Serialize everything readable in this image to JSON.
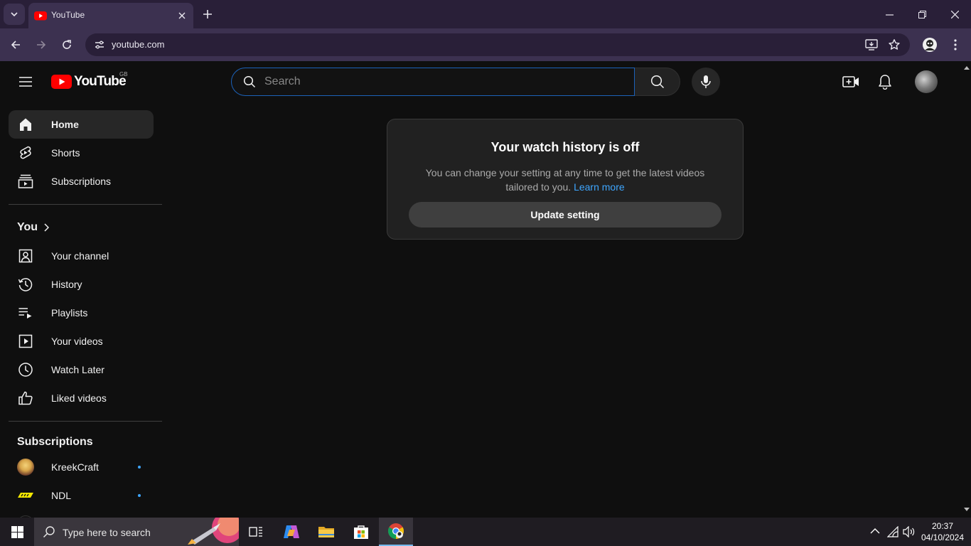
{
  "browser": {
    "tab_title": "YouTube",
    "url": "youtube.com"
  },
  "masthead": {
    "logo_text": "YouTube",
    "country_code": "GB",
    "search_placeholder": "Search"
  },
  "sidebar": {
    "main_items": [
      {
        "label": "Home",
        "icon": "home-icon",
        "active": true
      },
      {
        "label": "Shorts",
        "icon": "shorts-icon"
      },
      {
        "label": "Subscriptions",
        "icon": "subscriptions-icon"
      }
    ],
    "you_header": "You",
    "you_items": [
      {
        "label": "Your channel",
        "icon": "your-channel-icon"
      },
      {
        "label": "History",
        "icon": "history-icon"
      },
      {
        "label": "Playlists",
        "icon": "playlists-icon"
      },
      {
        "label": "Your videos",
        "icon": "your-videos-icon"
      },
      {
        "label": "Watch Later",
        "icon": "watch-later-icon"
      },
      {
        "label": "Liked videos",
        "icon": "liked-videos-icon"
      }
    ],
    "subscriptions_header": "Subscriptions",
    "subscriptions": [
      {
        "name": "KreekCraft",
        "new_content": true
      },
      {
        "name": "NDL",
        "new_content": true
      }
    ]
  },
  "main": {
    "card": {
      "heading": "Your watch history is off",
      "body": "You can change your setting at any time to get the latest videos tailored to you.",
      "link": "Learn more",
      "button": "Update setting"
    }
  },
  "taskbar": {
    "search_placeholder": "Type here to search",
    "time": "20:37",
    "date": "04/10/2024"
  },
  "colors": {
    "accent_blue": "#3ea6ff",
    "youtube_red": "#ff0000",
    "background": "#0f0f0f",
    "browser_frame": "#291f38"
  }
}
